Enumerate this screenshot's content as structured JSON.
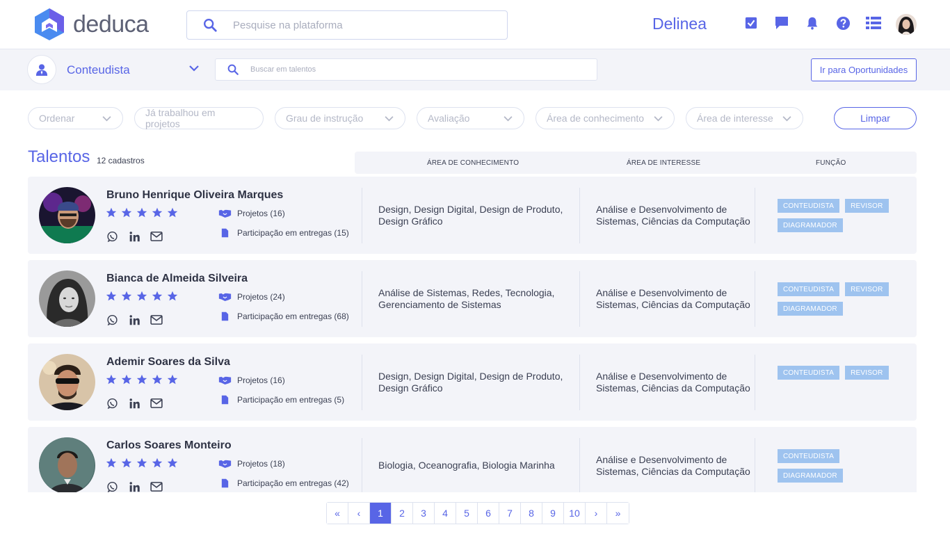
{
  "colors": {
    "accent": "#5865e6",
    "badge": "#9ec3ef",
    "card_bg": "#f3f4f9",
    "star": "#5865e6"
  },
  "header": {
    "logo_text": "deduca",
    "search_placeholder": "Pesquise na plataforma",
    "brand": "Delinea",
    "icons": [
      "checkbox-icon",
      "chat-icon",
      "bell-icon",
      "help-icon",
      "list-icon"
    ]
  },
  "subbar": {
    "role_label": "Conteudista",
    "search_placeholder": "Buscar em talentos",
    "opportunities_button": "Ir para Oportunidades"
  },
  "filters": {
    "items": [
      "Ordenar",
      "Já trabalhou em projetos",
      "Grau de instrução",
      "Avaliação",
      "Área de conhecimento",
      "Área de interesse"
    ],
    "clear_button": "Limpar"
  },
  "section": {
    "title": "Talentos",
    "count": "12 cadastros",
    "columns": [
      "ÁREA DE CONHECIMENTO",
      "ÁREA DE INTERESSE",
      "FUNÇÃO"
    ]
  },
  "talents": [
    {
      "name": "Bruno Henrique Oliveira Marques",
      "rating": 5,
      "projects": "Projetos (16)",
      "deliveries": "Participação em entregas (15)",
      "knowledge_area": "Design, Design Digital, Design de Produto, Design Gráfico",
      "interest_area": "Análise e Desenvolvimento de Sistemas, Ciências da Computação",
      "roles": [
        "CONTEUDISTA",
        "REVISOR",
        "DIAGRAMADOR"
      ]
    },
    {
      "name": "Bianca de Almeida Silveira",
      "rating": 5,
      "projects": "Projetos (24)",
      "deliveries": "Participação em entregas (68)",
      "knowledge_area": "Análise de Sistemas, Redes, Tecnologia, Gerenciamento de Sistemas",
      "interest_area": "Análise e Desenvolvimento de Sistemas, Ciências da Computação",
      "roles": [
        "CONTEUDISTA",
        "REVISOR",
        "DIAGRAMADOR"
      ]
    },
    {
      "name": "Ademir Soares da Silva",
      "rating": 5,
      "projects": "Projetos (16)",
      "deliveries": "Participação em entregas (5)",
      "knowledge_area": "Design, Design Digital, Design de Produto, Design Gráfico",
      "interest_area": "Análise e Desenvolvimento de Sistemas, Ciências da Computação",
      "roles": [
        "CONTEUDISTA",
        "REVISOR"
      ]
    },
    {
      "name": "Carlos Soares Monteiro",
      "rating": 5,
      "projects": "Projetos (18)",
      "deliveries": "Participação em entregas (42)",
      "knowledge_area": "Biologia, Oceanografia, Biologia Marinha",
      "interest_area": "Análise e Desenvolvimento de Sistemas, Ciências da Computação",
      "roles": [
        "CONTEUDISTA",
        "DIAGRAMADOR"
      ]
    }
  ],
  "pagination": {
    "first": "«",
    "prev": "‹",
    "pages": [
      "1",
      "2",
      "3",
      "4",
      "5",
      "6",
      "7",
      "8",
      "9",
      "10"
    ],
    "current": "1",
    "next": "›",
    "last": "»"
  }
}
